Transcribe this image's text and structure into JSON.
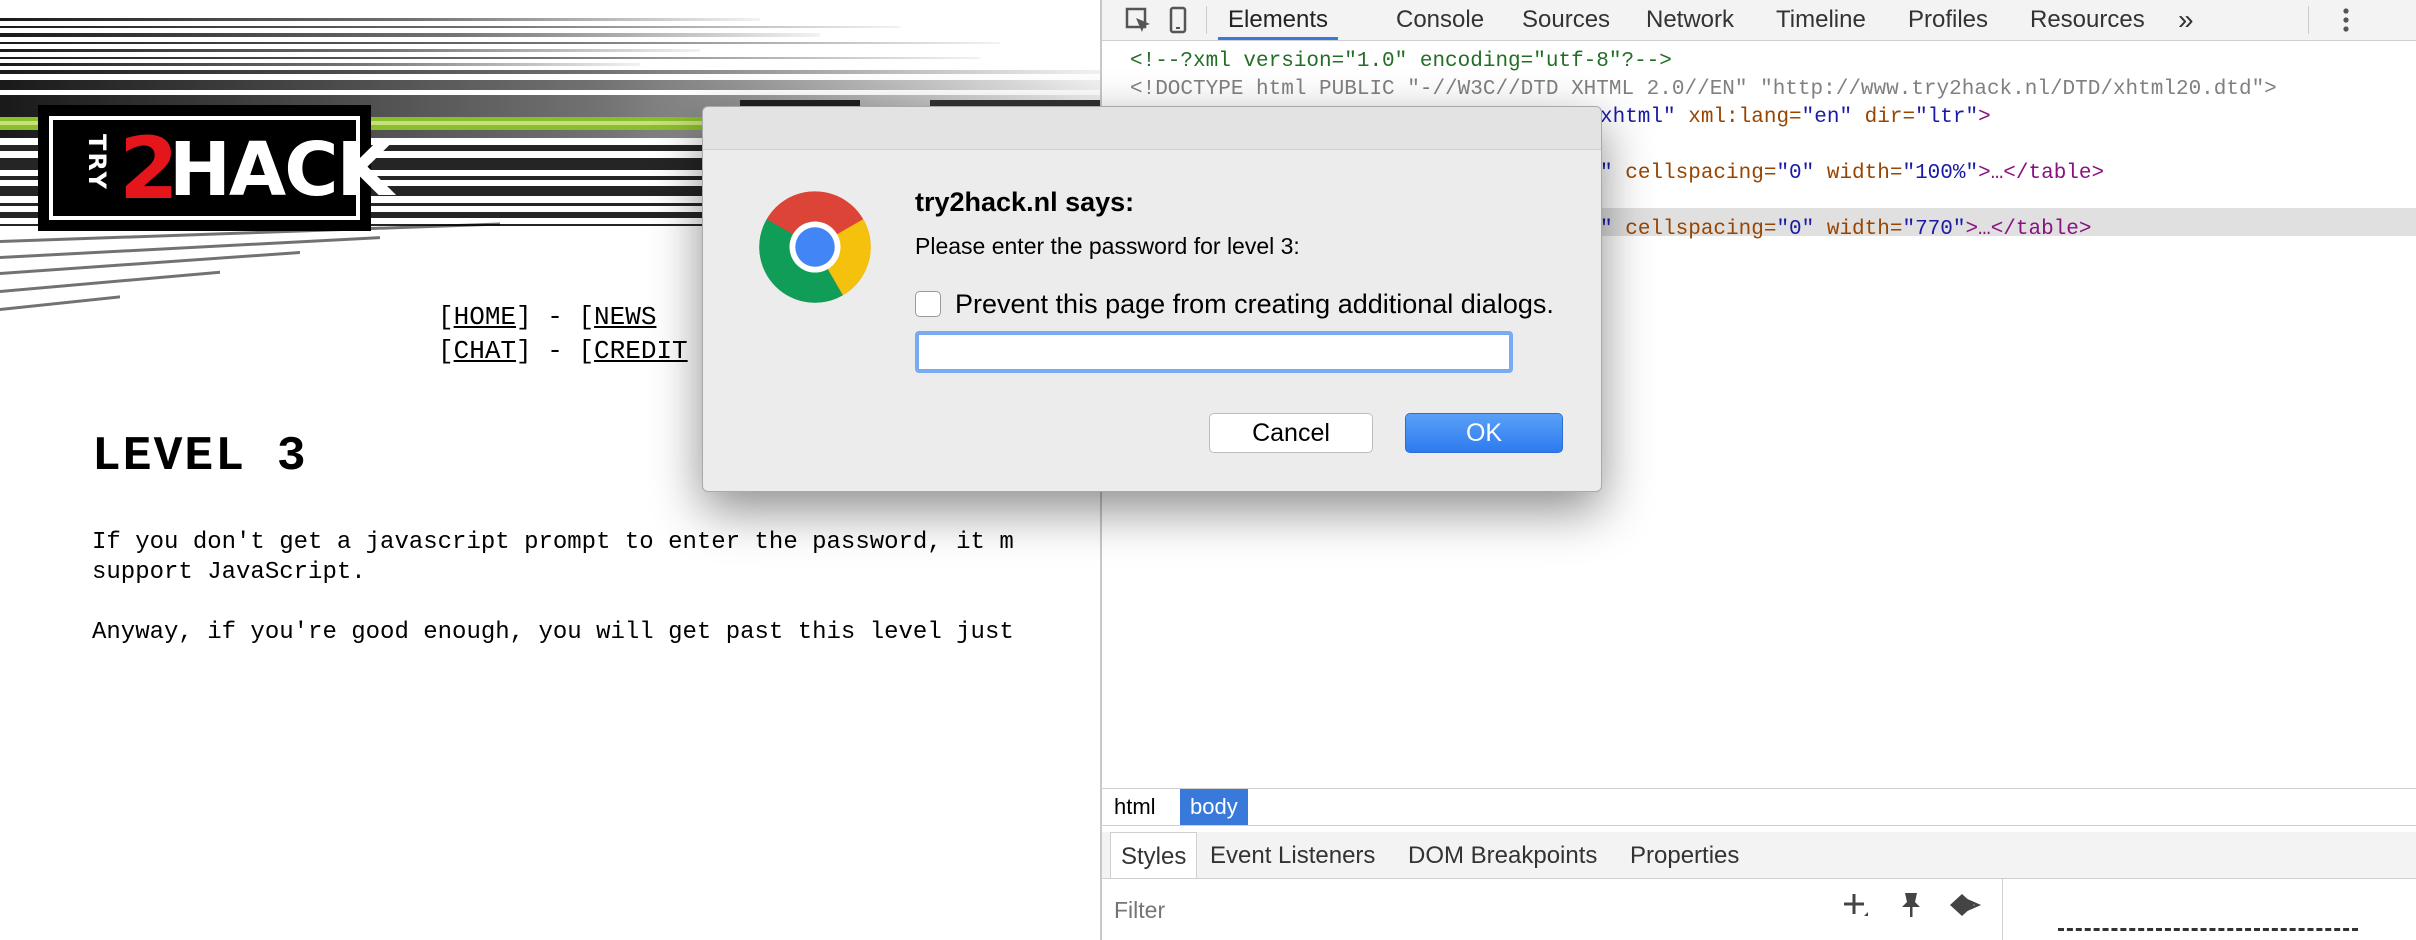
{
  "site": {
    "logo": {
      "try": "TRY",
      "two": "2",
      "hack": "HACK"
    },
    "nav": {
      "row1": {
        "home": "HOME",
        "sep1": "] - [",
        "news": "NEWS"
      },
      "row2": {
        "chat": "CHAT",
        "sep2": "] - [",
        "credit": "CREDIT"
      }
    },
    "level_title": "LEVEL 3",
    "body_line1": "If you don't get a javascript prompt to enter the password, it m",
    "body_line2": "support JavaScript.",
    "body_line3": "Anyway, if you're good enough, you will get past this level just"
  },
  "devtools": {
    "tabs": [
      "Elements",
      "Console",
      "Sources",
      "Network",
      "Timeline",
      "Profiles",
      "Resources"
    ],
    "more_tabs": "»",
    "dom": {
      "line1": "<!--?xml version=\"1.0\" encoding=\"utf-8\"?-->",
      "line2": "<!DOCTYPE html PUBLIC \"-//W3C//DTD XHTML 2.0//EN\" \"http://www.try2hack.nl/DTD/xhtml20.dtd\">",
      "line3_a": "xhtml\"",
      "line3_b": " xml:lang=",
      "line3_c": "\"en\"",
      "line3_d": " dir=",
      "line3_e": "\"ltr\"",
      "line3_f": ">",
      "table1_a": "\"",
      "table1_b": " cellspacing=",
      "table1_c": "\"0\"",
      "table1_d": " width=",
      "table1_e": "\"100%\"",
      "table1_f": ">…</table>",
      "table2_a": "\"",
      "table2_b": " cellspacing=",
      "table2_c": "\"0\"",
      "table2_d": " width=",
      "table2_e": "\"770\"",
      "table2_f": ">…</table>"
    },
    "breadcrumbs": [
      "html",
      "body"
    ],
    "style_tabs": [
      "Styles",
      "Event Listeners",
      "DOM Breakpoints",
      "Properties"
    ],
    "filter_placeholder": "Filter"
  },
  "dialog": {
    "title": "try2hack.nl says:",
    "message": "Please enter the password for level 3:",
    "prevent_label": "Prevent this page from creating additional dialogs.",
    "input_value": "",
    "cancel_label": "Cancel",
    "ok_label": "OK"
  },
  "colors": {
    "accent_blue": "#3879d9",
    "logo_red": "#e4151b",
    "banner_green": "#8bbf2a"
  },
  "icons": [
    "inspect-icon",
    "device-icon",
    "more-tabs-icon",
    "kebab-menu-icon",
    "chrome-logo-icon",
    "add-rule-icon",
    "pin-icon",
    "toggle-state-icon"
  ]
}
